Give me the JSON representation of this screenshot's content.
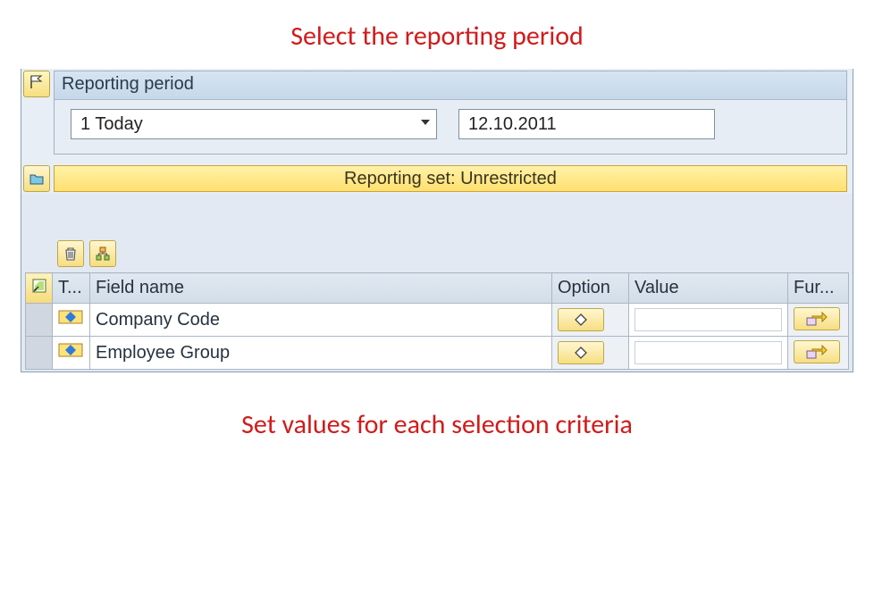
{
  "annotations": {
    "top": "Select the reporting period",
    "bottom": "Set values for each selection criteria"
  },
  "reporting_period": {
    "groupbox_title": "Reporting period",
    "dropdown_value": "1 Today",
    "date_value": "12.10.2011"
  },
  "reporting_set_bar": "Reporting set: Unrestricted",
  "table": {
    "headers": {
      "type": "T...",
      "field_name": "Field name",
      "option": "Option",
      "value": "Value",
      "further": "Fur..."
    },
    "rows": [
      {
        "field_name": "Company Code",
        "value": ""
      },
      {
        "field_name": "Employee Group",
        "value": ""
      }
    ]
  }
}
